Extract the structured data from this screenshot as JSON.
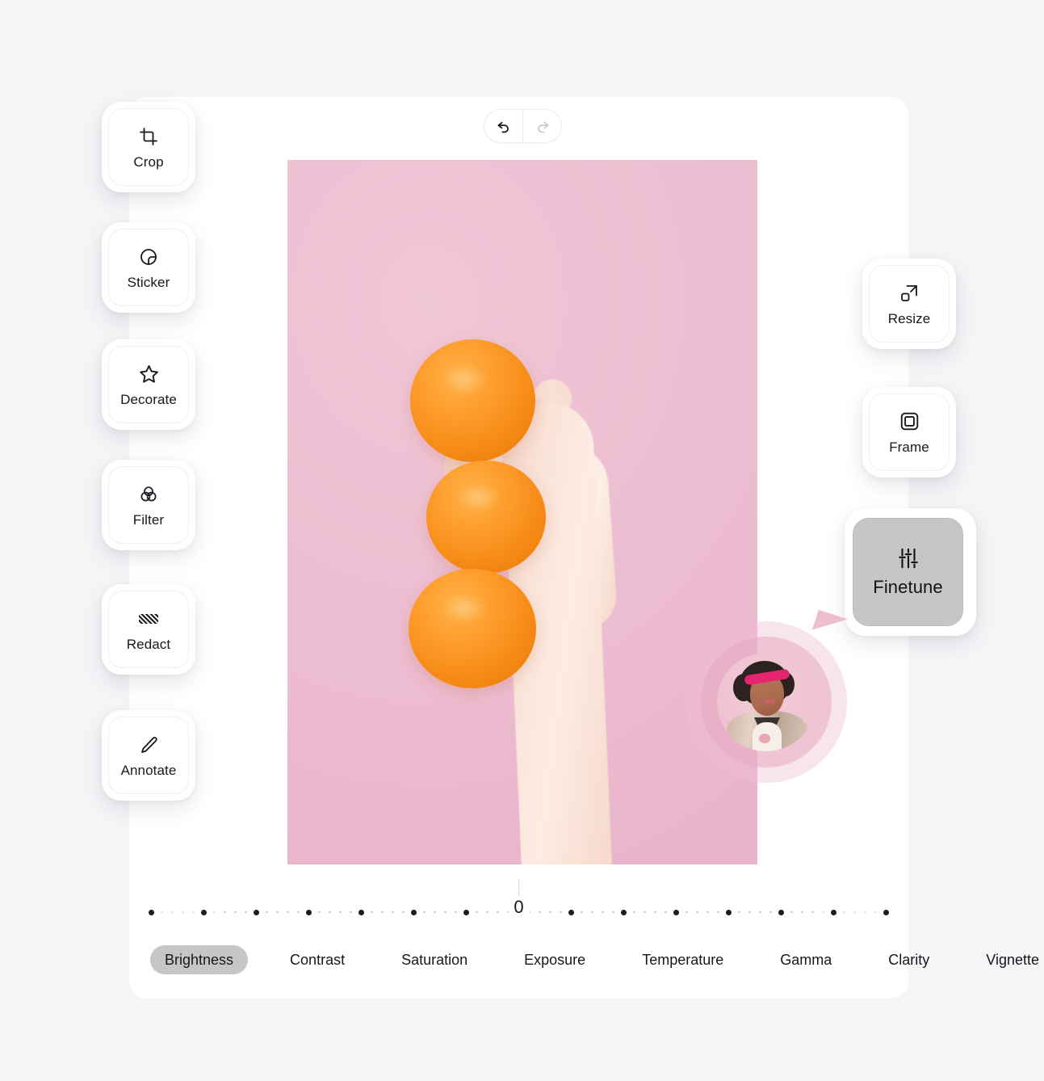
{
  "app": {
    "background_color": "#f4f5f7",
    "card_color": "#ffffff",
    "accent_active": "#c6c6c6",
    "cursor_color": "#eebdd0"
  },
  "history": {
    "undo_label": "Undo",
    "undo_icon": "undo-arrow-icon",
    "undo_enabled": "true",
    "redo_label": "Redo",
    "redo_icon": "redo-arrow-icon",
    "redo_enabled": "false"
  },
  "left_tools": [
    {
      "id": "crop",
      "label": "Crop",
      "icon": "crop-icon",
      "active": false
    },
    {
      "id": "sticker",
      "label": "Sticker",
      "icon": "sticker-icon",
      "active": false
    },
    {
      "id": "decorate",
      "label": "Decorate",
      "icon": "star-icon",
      "active": false
    },
    {
      "id": "filter",
      "label": "Filter",
      "icon": "filter-circles-icon",
      "active": false
    },
    {
      "id": "redact",
      "label": "Redact",
      "icon": "redact-hatch-icon",
      "active": false
    },
    {
      "id": "annotate",
      "label": "Annotate",
      "icon": "pencil-icon",
      "active": false
    }
  ],
  "right_tools": [
    {
      "id": "resize",
      "label": "Resize",
      "icon": "resize-arrow-icon",
      "active": false
    },
    {
      "id": "frame",
      "label": "Frame",
      "icon": "frame-square-icon",
      "active": false
    },
    {
      "id": "finetune",
      "label": "Finetune",
      "icon": "sliders-icon",
      "active": true
    }
  ],
  "canvas": {
    "image_alt": "three oranges stacked vertically beside a hand on a pink background",
    "background_color": "#edbfd2"
  },
  "collaborator": {
    "avatar_alt": "woman with pink sunglasses and satin bomber jacket",
    "ring_outer_color": "#eebed2",
    "ring_inner_color": "#e7aac3"
  },
  "slider": {
    "value": "0",
    "min": -50,
    "max": 50,
    "total_ticks": 71,
    "major_every": 5,
    "center_index": 35
  },
  "adjustments": {
    "selected": "Brightness",
    "tabs": [
      {
        "label": "Brightness",
        "active": true
      },
      {
        "label": "Contrast",
        "active": false
      },
      {
        "label": "Saturation",
        "active": false
      },
      {
        "label": "Exposure",
        "active": false
      },
      {
        "label": "Temperature",
        "active": false
      },
      {
        "label": "Gamma",
        "active": false
      },
      {
        "label": "Clarity",
        "active": false
      },
      {
        "label": "Vignette",
        "active": false
      }
    ]
  }
}
